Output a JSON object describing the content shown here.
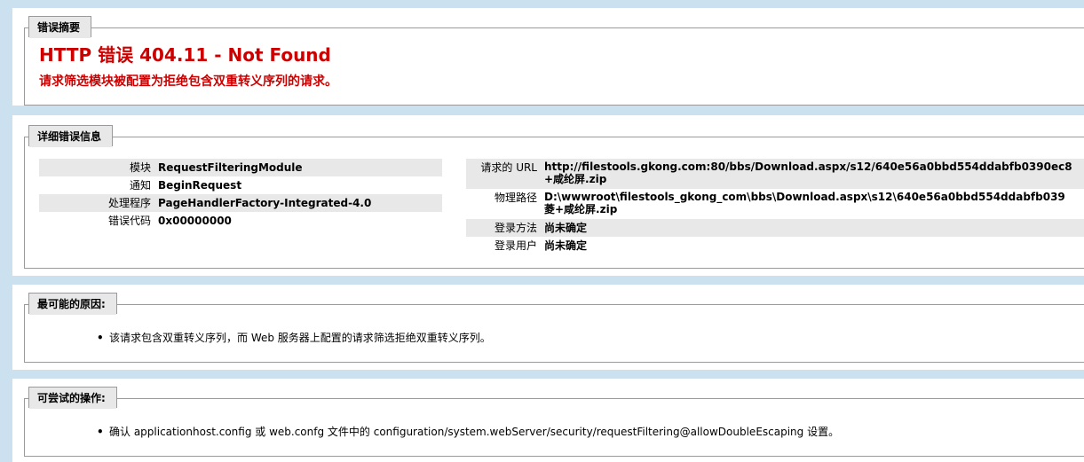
{
  "summary": {
    "legend": "错误摘要",
    "title": "HTTP 错误 404.11 - Not Found",
    "description": "请求筛选模块被配置为拒绝包含双重转义序列的请求。"
  },
  "details": {
    "legend": "详细错误信息",
    "left_rows": [
      {
        "label": "模块",
        "value": "RequestFilteringModule"
      },
      {
        "label": "通知",
        "value": "BeginRequest"
      },
      {
        "label": "处理程序",
        "value": "PageHandlerFactory-Integrated-4.0"
      },
      {
        "label": "错误代码",
        "value": "0x00000000"
      }
    ],
    "right_rows": [
      {
        "label": "请求的 URL",
        "value_line1": "http://filestools.gkong.com:80/bbs/Download.aspx/s12/640e56a0bbd554ddabfb0390ec8",
        "value_line2": "+咸纶屏.zip"
      },
      {
        "label": "物理路径",
        "value_line1": "D:\\wwwroot\\filestools_gkong_com\\bbs\\Download.aspx\\s12\\640e56a0bbd554ddabfb039",
        "value_line2": "菱+咸纶屏.zip"
      },
      {
        "label": "登录方法",
        "value": "尚未确定"
      },
      {
        "label": "登录用户",
        "value": "尚未确定"
      }
    ]
  },
  "causes": {
    "legend": "最可能的原因:",
    "bullet": "•",
    "items": [
      "该请求包含双重转义序列，而 Web 服务器上配置的请求筛选拒绝双重转义序列。"
    ]
  },
  "actions": {
    "legend": "可尝试的操作:",
    "bullet": "•",
    "items": [
      "确认 applicationhost.config 或 web.confg 文件中的 configuration/system.webServer/security/requestFiltering@allowDoubleEscaping 设置。"
    ]
  },
  "colors": {
    "background": "#cbe1ef",
    "error_red": "#cc0000",
    "row_alt": "#e8e8e8"
  }
}
